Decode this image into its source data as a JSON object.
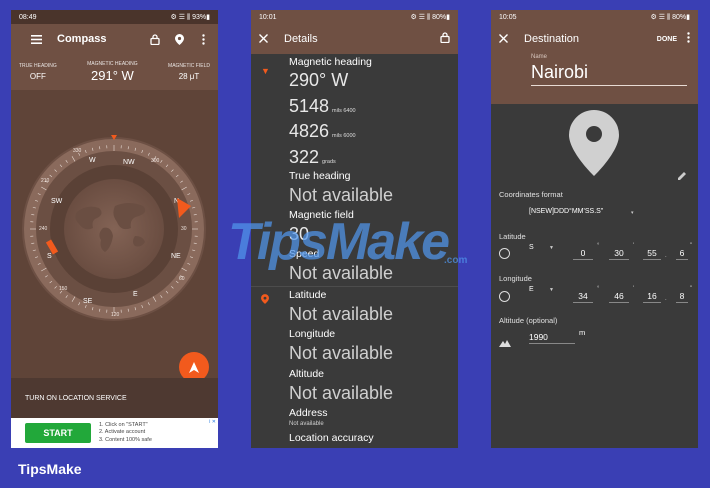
{
  "screen1": {
    "status_time": "08:49",
    "status_icons": "⚙ ☰ ⫼ 93%▮",
    "title": "Compass",
    "readouts": [
      {
        "label": "TRUE HEADING",
        "value": "OFF"
      },
      {
        "label": "MAGNETIC HEADING",
        "value": "291° W"
      },
      {
        "label": "MAGNETIC FIELD",
        "value": "28 μT"
      }
    ],
    "dial_labels": {
      "n": "N",
      "nw": "NW",
      "w": "W",
      "sw": "SW",
      "s": "S",
      "se": "SE",
      "e": "E",
      "ne": "NE",
      "deg_30": "30",
      "deg_60": "60",
      "deg_300": "300",
      "deg_330": "330",
      "deg_240": "240",
      "deg_210": "210",
      "deg_120": "120",
      "deg_150": "150"
    },
    "location_button": "TURN ON LOCATION SERVICE",
    "ad": {
      "start_label": "START",
      "steps": [
        "1. Click on \"START\"",
        "2. Activate account",
        "3. Content 100% safe"
      ],
      "badge": "i ✕"
    }
  },
  "screen2": {
    "status_time": "10:01",
    "status_icons": "⚙ ☰ ⫼ 80%▮",
    "title": "Details",
    "magnetic_heading_label": "Magnetic heading",
    "magnetic_heading_value": "290° W",
    "mils_6400_value": "5148",
    "mils_6400_unit": "mils 6400",
    "mils_6000_value": "4826",
    "mils_6000_unit": "mils 6000",
    "grads_value": "322",
    "grads_unit": "grads",
    "true_heading_label": "True heading",
    "true_heading_value": "Not available",
    "magnetic_field_label": "Magnetic field",
    "magnetic_field_value": "30",
    "speed_label": "Speed",
    "speed_value": "Not available",
    "latitude_label": "Latitude",
    "latitude_value": "Not available",
    "longitude_label": "Longitude",
    "longitude_value": "Not available",
    "altitude_label": "Altitude",
    "altitude_value": "Not available",
    "address_label": "Address",
    "address_value": "Not available",
    "accuracy_label": "Location accuracy"
  },
  "screen3": {
    "status_time": "10:05",
    "status_icons": "⚙ ☰ ⫼ 80%▮",
    "title": "Destination",
    "done_label": "DONE",
    "name_label": "Name",
    "name_value": "Nairobi",
    "coord_format_label": "Coordinates format",
    "coord_format_value": "[NSEW]DDD°MM'SS.S\"",
    "latitude_label": "Latitude",
    "lat_hemisphere": "S",
    "lat_deg": "0",
    "lat_min": "30",
    "lat_sec": "55",
    "lat_dec": "6",
    "longitude_label": "Longitude",
    "lon_hemisphere": "E",
    "lon_deg": "34",
    "lon_min": "46",
    "lon_sec": "16",
    "lon_dec": "8",
    "altitude_label": "Altitude (optional)",
    "altitude_value": "1990",
    "altitude_unit": "m",
    "deg_mark": "°",
    "min_mark": "'",
    "sec_mark": "\"",
    "caret": "▼",
    "caret_right": "▾"
  },
  "brand": "TipsMake",
  "watermark": "TipsMake",
  "watermark_sub": ".com",
  "colors": {
    "background": "#3a3fb4",
    "accent": "#f25a1d",
    "brown": "#6f5043",
    "ad_green": "#22a83a"
  }
}
